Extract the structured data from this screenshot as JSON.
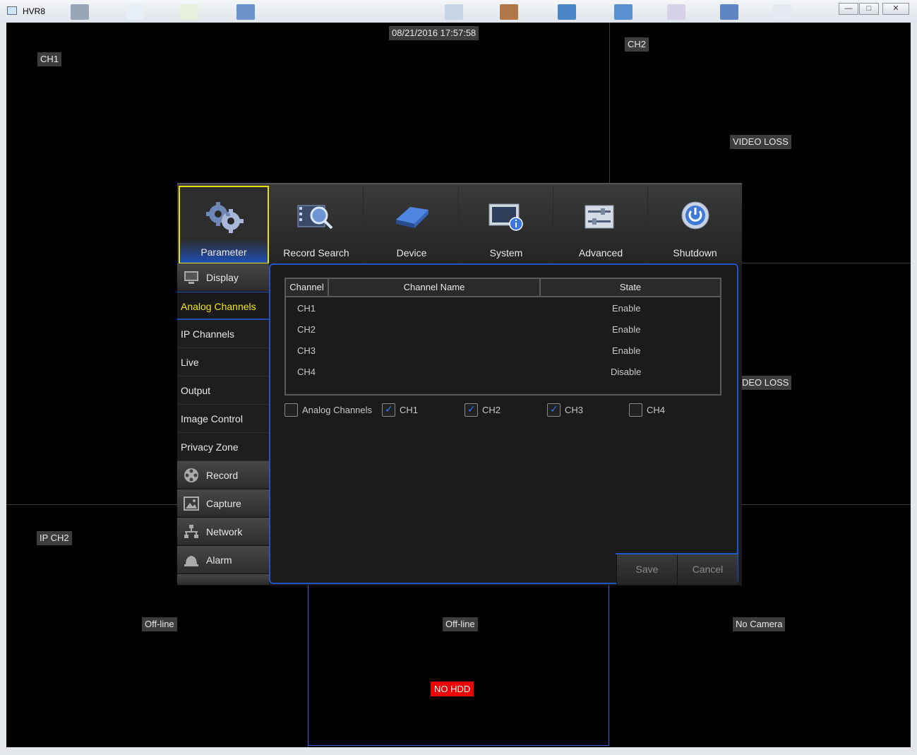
{
  "window": {
    "title": "HVR8",
    "controls": {
      "minimize": "—",
      "maximize": "□",
      "close": "✕"
    }
  },
  "osd": {
    "timestamp": "08/21/2016 17:57:58",
    "cells": {
      "ch1": "CH1",
      "ch2": "CH2",
      "video_loss_1": "VIDEO LOSS",
      "video_loss_2": "DEO LOSS",
      "ip_ch2": "IP CH2",
      "offline_1": "Off-line",
      "offline_2": "Off-line",
      "no_camera": "No Camera",
      "no_hdd": "NO HDD"
    }
  },
  "top_tabs": [
    {
      "label": "Parameter",
      "icon": "gears-icon",
      "active": true
    },
    {
      "label": "Record Search",
      "icon": "film-search-icon"
    },
    {
      "label": "Device",
      "icon": "hdd-icon"
    },
    {
      "label": "System",
      "icon": "system-info-icon"
    },
    {
      "label": "Advanced",
      "icon": "sliders-icon"
    },
    {
      "label": "Shutdown",
      "icon": "power-icon"
    }
  ],
  "sidebar": {
    "display": "Display",
    "items": [
      "Analog Channels",
      "IP Channels",
      "Live",
      "Output",
      "Image Control",
      "Privacy Zone"
    ],
    "record": "Record",
    "capture": "Capture",
    "network": "Network",
    "alarm": "Alarm"
  },
  "table": {
    "headers": {
      "channel": "Channel",
      "name": "Channel Name",
      "state": "State"
    },
    "rows": [
      {
        "channel": "CH1",
        "name": "",
        "state": "Enable"
      },
      {
        "channel": "CH2",
        "name": "",
        "state": "Enable"
      },
      {
        "channel": "CH3",
        "name": "",
        "state": "Enable"
      },
      {
        "channel": "CH4",
        "name": "",
        "state": "Disable"
      }
    ]
  },
  "checkboxes": {
    "all": {
      "label": "Analog Channels",
      "checked": false
    },
    "ch1": {
      "label": "CH1",
      "checked": true
    },
    "ch2": {
      "label": "CH2",
      "checked": true
    },
    "ch3": {
      "label": "CH3",
      "checked": true
    },
    "ch4": {
      "label": "CH4",
      "checked": false
    }
  },
  "buttons": {
    "save": "Save",
    "cancel": "Cancel"
  },
  "colors": {
    "accent": "#1f55c6",
    "active_tab_border": "#e8e000",
    "active_side_text": "#f0e600",
    "alert": "#ee0000"
  }
}
